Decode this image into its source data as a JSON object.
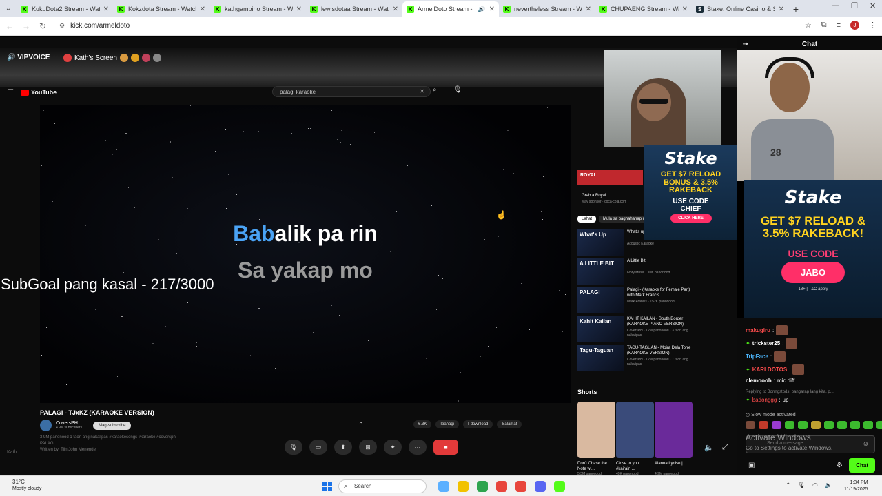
{
  "browser": {
    "tabs": [
      {
        "label": "KukuDota2 Stream - Watch",
        "fav": "K",
        "active": false
      },
      {
        "label": "Kokzdota Stream - Watch Li",
        "fav": "K",
        "active": false
      },
      {
        "label": "kathgambino Stream - Watc",
        "fav": "K",
        "active": false
      },
      {
        "label": "lewisdotaa Stream - Watch L",
        "fav": "K",
        "active": false
      },
      {
        "label": "ArmelDoto Stream - Wat",
        "fav": "K",
        "active": true
      },
      {
        "label": "nevertheless Stream - Watc",
        "fav": "K",
        "active": false
      },
      {
        "label": "CHUPAENG Stream - Watch",
        "fav": "K",
        "active": false
      },
      {
        "label": "Stake: Online Casino & Spor",
        "fav": "S",
        "active": false
      }
    ],
    "url": "kick.com/armeldoto",
    "profile_initial": "J"
  },
  "stream_overlay": {
    "vipvoice": "VIPVOICE",
    "screen_label": "Kath's Screen",
    "subgoal": "SubGoal pang kasal - 217/3000",
    "watermark": "Kath"
  },
  "youtube": {
    "logo": "YouTube",
    "search_query": "palagi karaoke",
    "lyric_highlight": "Bab",
    "lyric_rest": "alik pa rin",
    "lyric_next": "Sa yakap mo",
    "video_title": "PALAGI - TJxKZ (KARAOKE VERSION)",
    "channel_name": "CoversPH",
    "channel_subs": "4.9M subscribers",
    "subscribe_label": "Mag-subscribe",
    "actions": [
      "6.3K",
      "Ibahagi",
      "I-download",
      "Salamat"
    ],
    "description": "3.9M panonood  1 taon ang nakalipas  #karaokesongs #karaoke #coversph",
    "desc_line2": "PALAGI",
    "desc_line3": "Written by: Tiin John Menende",
    "chips": [
      "Lahat",
      "Mula sa paghahanap mo"
    ],
    "sponsor_title": "Grab a Royal",
    "sponsor_meta": "May sponsor · coca-cola.com",
    "suggested": [
      {
        "thumb": "What's Up",
        "title": "What's up - Non Blon",
        "meta": "Acoustic Karaoke"
      },
      {
        "thumb": "A LITTLE BIT",
        "title": "A Little Bit",
        "meta": "Ivory Music · 10K panonood"
      },
      {
        "thumb": "PALAGI",
        "title": "Palagi - (Karaoke for Female Part) with Mark Francis",
        "meta": "Mark Francis · 152K panonood"
      },
      {
        "thumb": "Kahit Kailan",
        "title": "KAHIT KAILAN - South Border (KARAOKE PIANO VERSION)",
        "meta": "CoversPH · 12M panonood · 3 taon ang nakalipas"
      },
      {
        "thumb": "Tagu-Taguan",
        "title": "TAGU-TAGUAN - Moira Dela Torre (KARAOKE VERSION)",
        "meta": "CoversPH · 12M panonood · 7 taon ang nakalipas"
      }
    ],
    "shorts_label": "Shorts",
    "shorts": [
      {
        "title": "Don't Chase the Note wi...",
        "views": "5.3M panonood",
        "color": "#d9b9a0"
      },
      {
        "title": "Close to you #kairain ...",
        "views": "49K panonood",
        "color": "#3a4b7a"
      },
      {
        "title": "Alanna Lynise | ...",
        "views": "4.9M panonood",
        "color": "#6a2a9a"
      }
    ]
  },
  "stake_ad_small": {
    "logo": "Stake",
    "line1": "GET $7 RELOAD",
    "line2": "BONUS & 3.5%",
    "line3": "RAKEBACK",
    "code_label": "USE CODE",
    "code": "CHIEF",
    "cta": "CLICK HERE"
  },
  "stake_ad_big": {
    "logo": "Stake",
    "line1": "GET $7 RELOAD &",
    "line2": "3.5% RAKEBACK!",
    "code_label": "USE CODE",
    "code": "JABO",
    "fine": "18+ | T&C apply"
  },
  "chat": {
    "title": "Chat",
    "messages": [
      {
        "user": "makugiru",
        "color": "#ff4d4d",
        "text": ""
      },
      {
        "user": "trickster25",
        "color": "#ffffff",
        "text": ""
      },
      {
        "user": "TripFace",
        "color": "#4db8ff",
        "text": ""
      },
      {
        "user": "KARLDOTOS",
        "color": "#ff4d4d",
        "text": ""
      },
      {
        "user": "clemoooh",
        "color": "#ffffff",
        "text": "mic diff"
      }
    ],
    "reply_note": "Replying to Bonngstods: pangarap lang kita, p...",
    "reply_user": "badonggg",
    "reply_text": "up",
    "slow_mode": "Slow mode activated",
    "input_placeholder": "Send a message",
    "send_label": "Chat",
    "activate_title": "Activate Windows",
    "activate_sub": "Go to Settings to activate Windows."
  },
  "taskbar": {
    "temp": "31°C",
    "weather": "Mostly cloudy",
    "search": "Search",
    "time": "1:34 PM",
    "date": "11/19/2025"
  }
}
